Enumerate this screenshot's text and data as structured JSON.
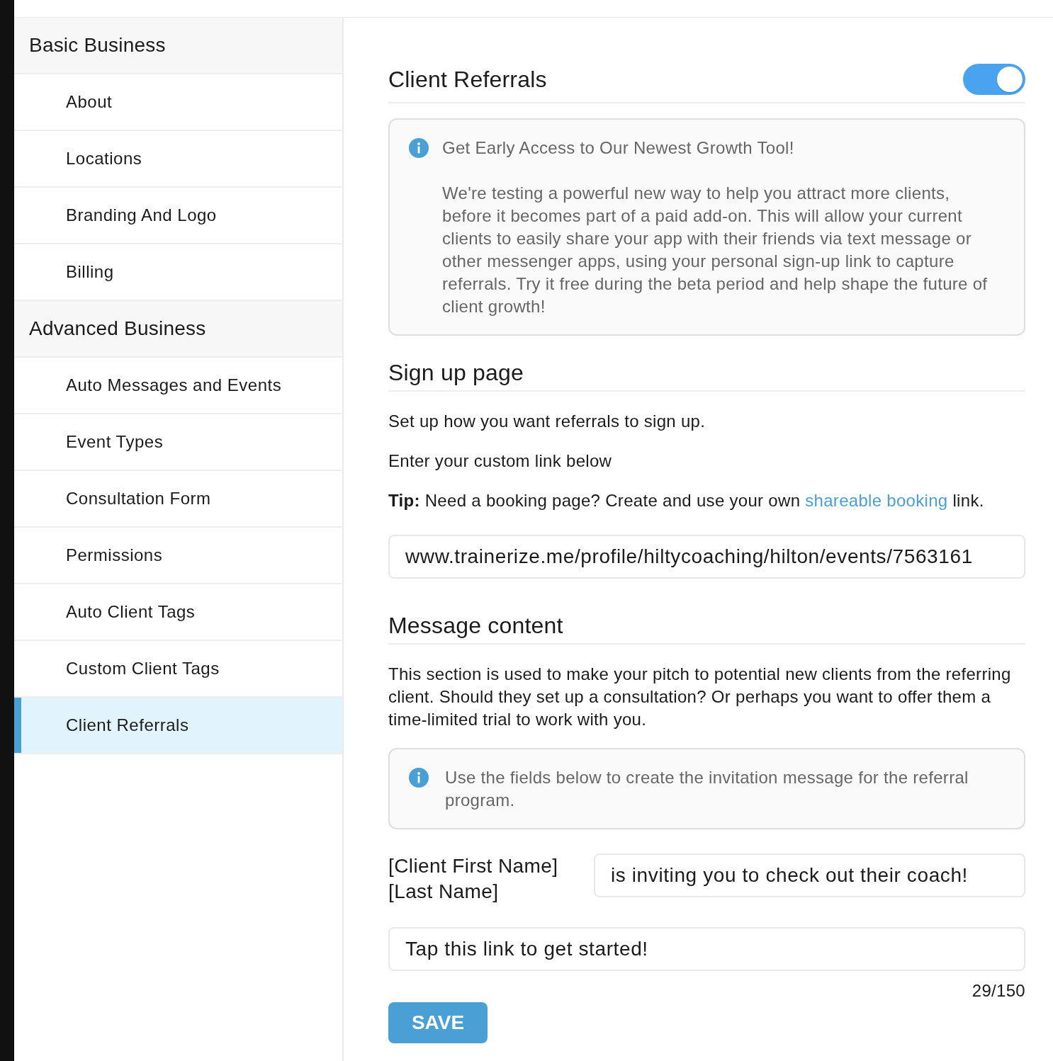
{
  "sidebar": {
    "groups": [
      {
        "title": "Basic Business",
        "items": [
          {
            "label": "About",
            "selected": false
          },
          {
            "label": "Locations",
            "selected": false
          },
          {
            "label": "Branding And Logo",
            "selected": false
          },
          {
            "label": "Billing",
            "selected": false
          }
        ]
      },
      {
        "title": "Advanced Business",
        "items": [
          {
            "label": "Auto Messages and Events",
            "selected": false
          },
          {
            "label": "Event Types",
            "selected": false
          },
          {
            "label": "Consultation Form",
            "selected": false
          },
          {
            "label": "Permissions",
            "selected": false
          },
          {
            "label": "Auto Client Tags",
            "selected": false
          },
          {
            "label": "Custom Client Tags",
            "selected": false
          },
          {
            "label": "Client Referrals",
            "selected": true
          }
        ]
      }
    ]
  },
  "content": {
    "title": "Client Referrals",
    "toggle": {
      "on": true
    },
    "beta_notice": {
      "heading": "Get Early Access to Our Newest Growth Tool!",
      "body": "We're testing a powerful new way to help you attract more clients, before it becomes part of a paid add-on. This will allow your current clients to easily share your app with their friends via text message or other messenger apps, using your personal sign-up link to capture referrals. Try it free during the beta period and help shape the future of client growth!"
    },
    "signup": {
      "title": "Sign up page",
      "paragraphs": [
        "Set up how you want referrals to sign up.",
        "Enter your custom link below"
      ],
      "tip": {
        "before": "**Tip:** Need a booking page? Create and use your own ",
        "link": "shareable booking",
        "after": " link."
      },
      "link_field": {
        "value": "www.trainerize.me/profile/hiltycoaching/hilton/events/7563161"
      }
    },
    "message": {
      "title": "Message content",
      "description": "This section is used to make your pitch to potential new clients from the referring client. Should they set up a consultation? Or perhaps you want to offer them a time-limited trial to work with you.",
      "notice": "Use the fields below to create the invitation message for the referral program.",
      "name_label": "[Client First Name] [Last Name]",
      "invite_field": {
        "value": "is inviting you to check out their coach!"
      },
      "cta_field": {
        "value": "Tap this link to get started!"
      },
      "counter": "29/150"
    },
    "save_button": "SAVE"
  }
}
